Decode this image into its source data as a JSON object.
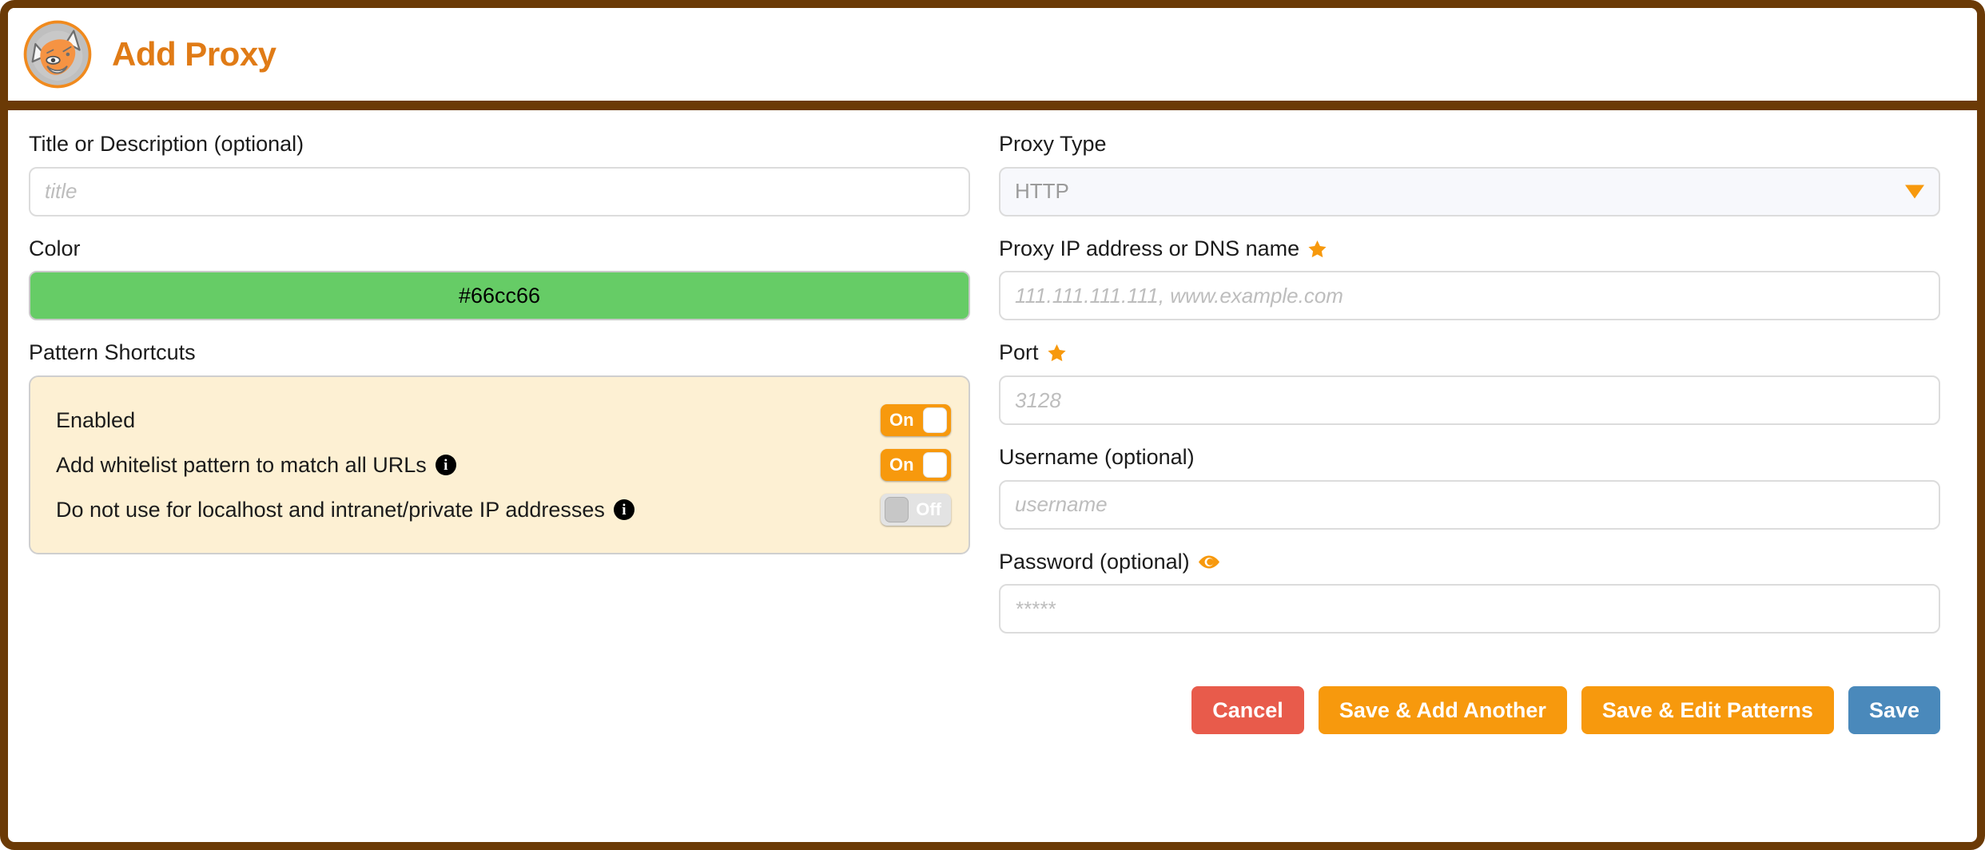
{
  "header": {
    "title": "Add Proxy",
    "logo_icon": "foxyproxy-fox-logo",
    "brand_color": "#e07b16",
    "border_color": "#6b3a06"
  },
  "left_column": {
    "title_field": {
      "label": "Title or Description (optional)",
      "placeholder": "title",
      "value": ""
    },
    "color_field": {
      "label": "Color",
      "value": "#66cc66",
      "swatch_color": "#66cc66"
    },
    "pattern_shortcuts": {
      "label": "Pattern Shortcuts",
      "panel_color": "#fdf0d3",
      "rows": [
        {
          "text": "Enabled",
          "has_info_icon": false,
          "toggle_state": "On",
          "toggle_label": "On"
        },
        {
          "text": "Add whitelist pattern to match all URLs",
          "has_info_icon": true,
          "info_icon": "info-circle-icon",
          "toggle_state": "On",
          "toggle_label": "On"
        },
        {
          "text": "Do not use for localhost and intranet/private IP addresses",
          "has_info_icon": true,
          "info_icon": "info-circle-icon",
          "toggle_state": "Off",
          "toggle_label": "Off"
        }
      ]
    }
  },
  "right_column": {
    "proxy_type": {
      "label": "Proxy Type",
      "selected": "HTTP",
      "arrow_icon": "chevron-down-icon",
      "arrow_color": "#f7990d"
    },
    "proxy_address": {
      "label": "Proxy IP address or DNS name",
      "required_icon": "star-icon",
      "placeholder": "111.111.111.111, www.example.com",
      "value": ""
    },
    "port": {
      "label": "Port",
      "required_icon": "star-icon",
      "placeholder": "3128",
      "value": ""
    },
    "username": {
      "label": "Username (optional)",
      "placeholder": "username",
      "value": ""
    },
    "password": {
      "label": "Password (optional)",
      "reveal_icon": "eye-icon",
      "placeholder": "*****",
      "value": ""
    }
  },
  "buttons": {
    "cancel": {
      "label": "Cancel",
      "color": "#e85b4b"
    },
    "save_add_another": {
      "label": "Save & Add Another",
      "color": "#f7990d"
    },
    "save_edit_patterns": {
      "label": "Save & Edit Patterns",
      "color": "#f7990d"
    },
    "save": {
      "label": "Save",
      "color": "#4a89bb"
    }
  }
}
